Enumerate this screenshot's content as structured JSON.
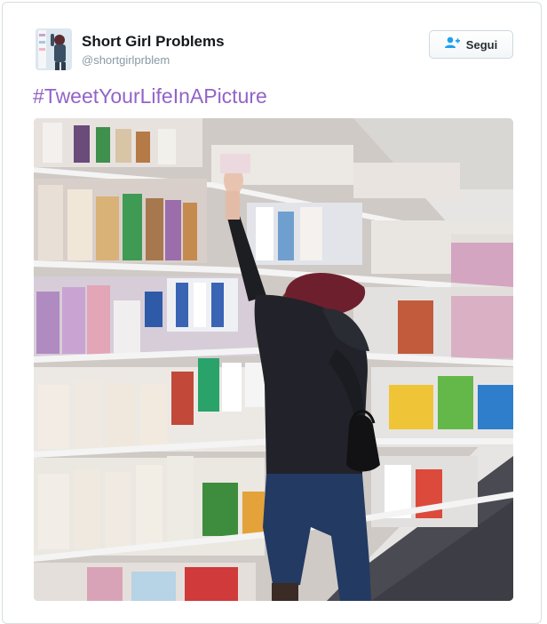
{
  "tweet": {
    "display_name": "Short Girl Problems",
    "handle": "@shortgirlprblem",
    "follow_label": "Segui",
    "hashtag_text": "#TweetYourLifeInAPicture",
    "icons": {
      "avatar": "avatar-photo",
      "follow": "add-user-icon"
    },
    "colors": {
      "hashtag": "#9263c8",
      "name": "#14171a",
      "handle": "#8899a6",
      "follow_icon": "#1da1f2"
    }
  }
}
